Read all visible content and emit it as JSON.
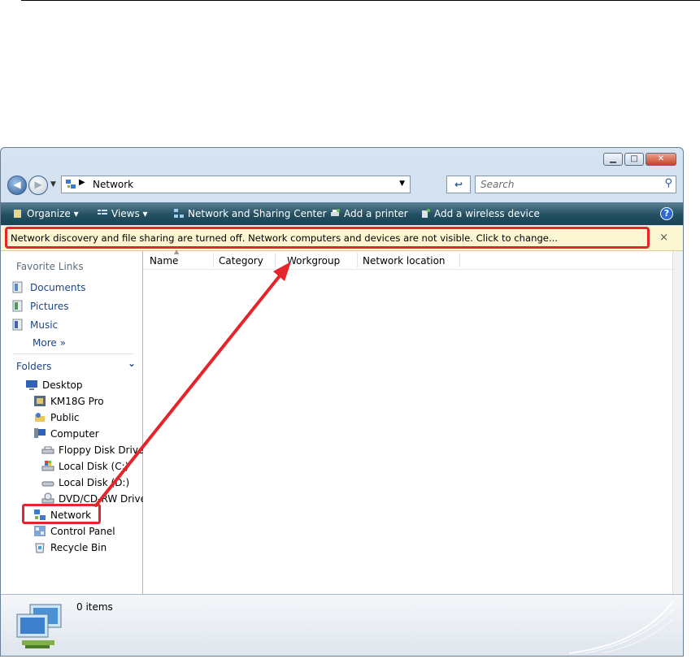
{
  "window": {
    "title_buttons": {
      "minimize": "▁",
      "maximize": "□",
      "close": "✕"
    }
  },
  "address": {
    "location": "Network",
    "search_placeholder": "Search"
  },
  "toolbar": {
    "organize": "Organize",
    "views": "Views",
    "network_sharing_center": "Network and Sharing Center",
    "add_printer": "Add a printer",
    "add_wireless": "Add a wireless device",
    "help": "?"
  },
  "infobar": {
    "message": "Network discovery and file sharing are turned off. Network computers and devices are not visible. Click to change...",
    "close": "×"
  },
  "navigation": {
    "favorite_links_heading": "Favorite Links",
    "favorite_links": [
      "Documents",
      "Pictures",
      "Music"
    ],
    "more": "More  »",
    "folders_heading": "Folders",
    "tree": [
      {
        "label": "Desktop",
        "icon": "desktop-icon"
      },
      {
        "label": "KM18G Pro",
        "icon": "user-folder-icon"
      },
      {
        "label": "Public",
        "icon": "public-folder-icon"
      },
      {
        "label": "Computer",
        "icon": "computer-icon"
      },
      {
        "label": "Floppy Disk Drive",
        "icon": "floppy-drive-icon"
      },
      {
        "label": "Local Disk (C:)",
        "icon": "local-disk-icon"
      },
      {
        "label": "Local Disk (D:)",
        "icon": "local-disk-icon"
      },
      {
        "label": "DVD/CD-RW Drive",
        "icon": "dvd-drive-icon"
      },
      {
        "label": "Network",
        "icon": "network-icon"
      },
      {
        "label": "Control Panel",
        "icon": "control-panel-icon"
      },
      {
        "label": "Recycle Bin",
        "icon": "recycle-bin-icon"
      }
    ]
  },
  "columns": [
    "Name",
    "Category",
    "Workgroup",
    "Network location"
  ],
  "details": {
    "item_count": "0 items"
  },
  "colors": {
    "highlight": "#e4252c",
    "toolbar": "#234f62",
    "infobar": "#fbf7d2"
  }
}
